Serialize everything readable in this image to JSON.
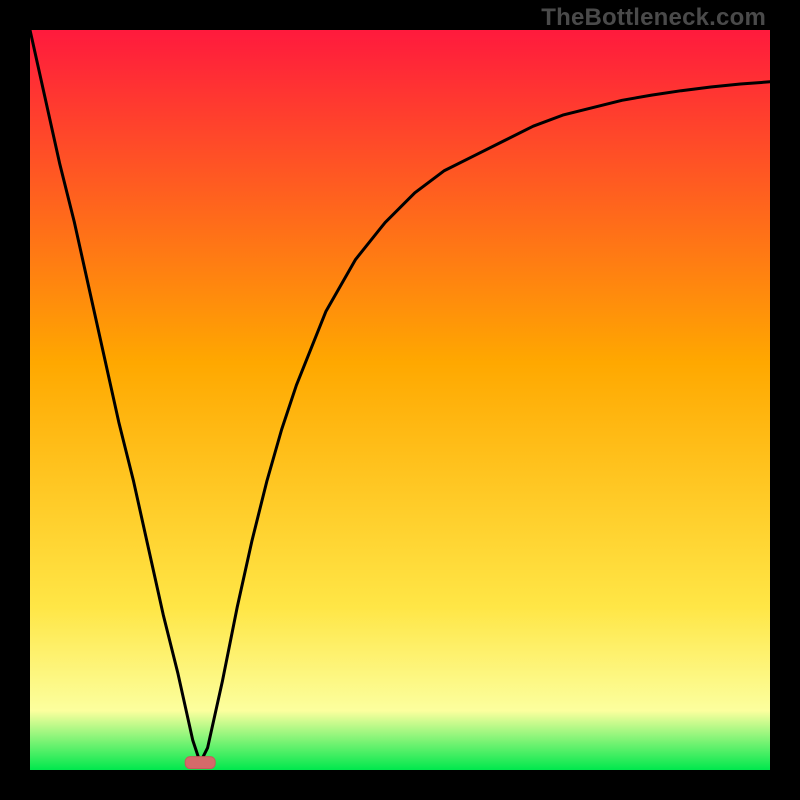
{
  "watermark": "TheBottleneck.com",
  "colors": {
    "frame": "#000000",
    "grad_top": "#ff1a3d",
    "grad_mid": "#ffa800",
    "grad_low": "#ffe646",
    "grad_pale": "#fcff9e",
    "grad_green": "#00e84d",
    "curve": "#000000",
    "marker_fill": "#d46a6a",
    "marker_stroke": "#c75b5b"
  },
  "chart_data": {
    "type": "line",
    "title": "",
    "xlabel": "",
    "ylabel": "",
    "xlim": [
      0,
      100
    ],
    "ylim": [
      0,
      100
    ],
    "series": [
      {
        "name": "bottleneck-curve",
        "x": [
          0,
          2,
          4,
          6,
          8,
          10,
          12,
          14,
          16,
          18,
          20,
          22,
          23,
          24,
          26,
          28,
          30,
          32,
          34,
          36,
          38,
          40,
          44,
          48,
          52,
          56,
          60,
          64,
          68,
          72,
          76,
          80,
          84,
          88,
          92,
          96,
          100
        ],
        "y": [
          100,
          91,
          82,
          74,
          65,
          56,
          47,
          39,
          30,
          21,
          13,
          4,
          1,
          3,
          12,
          22,
          31,
          39,
          46,
          52,
          57,
          62,
          69,
          74,
          78,
          81,
          83,
          85,
          87,
          88.5,
          89.5,
          90.5,
          91.2,
          91.8,
          92.3,
          92.7,
          93
        ]
      }
    ],
    "marker": {
      "x": 23,
      "y": 1,
      "label": ""
    },
    "gradient_stops": [
      {
        "pct": 0,
        "color_key": "grad_top"
      },
      {
        "pct": 45,
        "color_key": "grad_mid"
      },
      {
        "pct": 78,
        "color_key": "grad_low"
      },
      {
        "pct": 92,
        "color_key": "grad_pale"
      },
      {
        "pct": 100,
        "color_key": "grad_green"
      }
    ]
  }
}
